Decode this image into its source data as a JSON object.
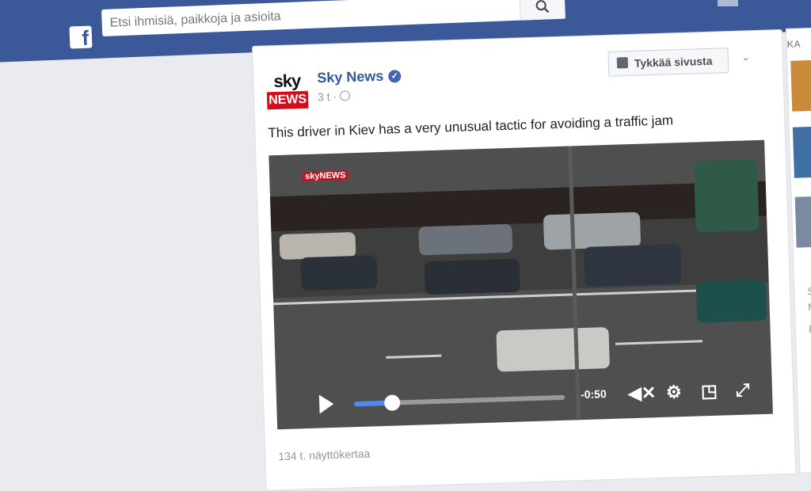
{
  "header": {
    "search_placeholder": "Etsi ihmisiä, paikkoja ja asioita"
  },
  "post": {
    "page_name": "Sky News",
    "logo_top": "sky",
    "logo_bottom": "NEWS",
    "time": "3 t ·",
    "like_page_label": "Tykkää sivusta",
    "caption": "This driver in Kiev has a very unusual tactic for avoiding a traffic jam",
    "video": {
      "overlay_logo": "skyNEWS",
      "time_remaining": "-0:50",
      "progress": 0.17
    },
    "views": "134 t. näyttökertaa"
  },
  "right_column": {
    "heading": "KA",
    "texts": [
      "Su",
      "Ma",
      "Fa"
    ]
  },
  "colors": {
    "brand": "#3b5998",
    "link": "#365899",
    "sky_red": "#d50c1a",
    "progress": "#4b8bf5"
  }
}
